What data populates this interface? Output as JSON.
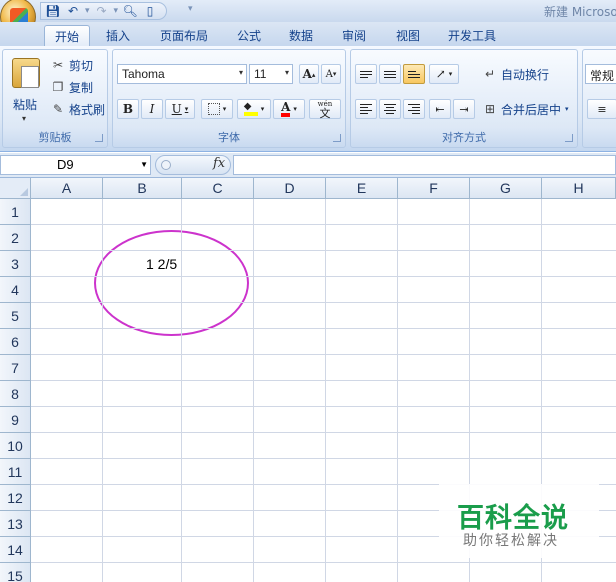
{
  "window": {
    "title": "新建 Microsoft"
  },
  "quick_access": {
    "icons": [
      "save-icon",
      "undo-icon",
      "redo-icon",
      "print-preview-icon",
      "new-document-icon",
      "customize-icon"
    ]
  },
  "tabs": [
    {
      "label": "开始",
      "active": true
    },
    {
      "label": "插入"
    },
    {
      "label": "页面布局"
    },
    {
      "label": "公式"
    },
    {
      "label": "数据"
    },
    {
      "label": "审阅"
    },
    {
      "label": "视图"
    },
    {
      "label": "开发工具"
    }
  ],
  "clipboard": {
    "paste": "粘贴",
    "cut": "剪切",
    "copy": "复制",
    "format_painter": "格式刷",
    "group_label": "剪贴板"
  },
  "font": {
    "name": "Tahoma",
    "size": "11",
    "grow": "A",
    "shrink": "A",
    "bold": "B",
    "italic": "I",
    "underline": "U",
    "font_color_letter": "A",
    "phonetic": "wén",
    "phonetic_char": "文",
    "group_label": "字体",
    "fill_color": "#ffff00",
    "font_color": "#ff0000"
  },
  "alignment": {
    "wrap_text": "自动换行",
    "merge_center": "合并后居中",
    "group_label": "对齐方式"
  },
  "number": {
    "format": "常规"
  },
  "formula_bar": {
    "name_box": "D9",
    "fx": "fx",
    "formula": ""
  },
  "sheet": {
    "columns": [
      "A",
      "B",
      "C",
      "D",
      "E",
      "F",
      "G",
      "H"
    ],
    "rows": [
      "1",
      "2",
      "3",
      "4",
      "5",
      "6",
      "7",
      "8",
      "9",
      "10",
      "11",
      "12",
      "13",
      "14",
      "15"
    ],
    "cells": [
      {
        "ref": "B3",
        "value": "1 2/5"
      }
    ],
    "annotation_color": "#cc33cc"
  },
  "watermark": {
    "title": "百科全说",
    "subtitle": "助你轻松解决"
  }
}
